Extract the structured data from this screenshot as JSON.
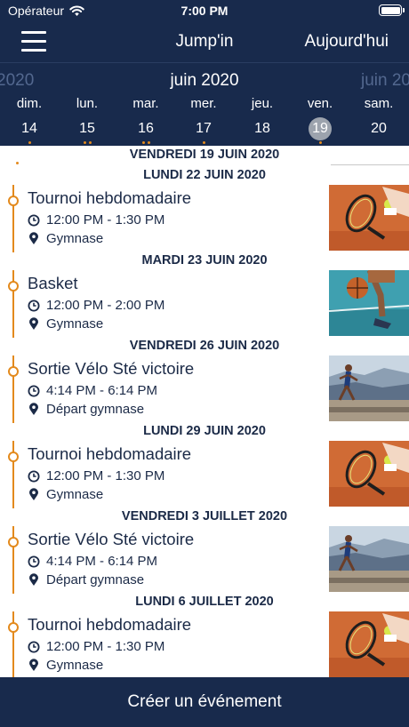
{
  "status": {
    "carrier": "Opérateur",
    "time": "7:00 PM"
  },
  "nav": {
    "title": "Jump'in",
    "today_label": "Aujourd'hui"
  },
  "calendar": {
    "prev_month_fragment": "2020",
    "month": "juin 2020",
    "next_month_fragment": "juin 20",
    "days": [
      {
        "name": "dim.",
        "num": "14",
        "dots": 1,
        "selected": false
      },
      {
        "name": "lun.",
        "num": "15",
        "dots": 2,
        "selected": false
      },
      {
        "name": "mar.",
        "num": "16",
        "dots": 2,
        "selected": false
      },
      {
        "name": "mer.",
        "num": "17",
        "dots": 1,
        "selected": false
      },
      {
        "name": "jeu.",
        "num": "18",
        "dots": 0,
        "selected": false
      },
      {
        "name": "ven.",
        "num": "19",
        "dots": 1,
        "selected": true
      },
      {
        "name": "sam.",
        "num": "20",
        "dots": 0,
        "selected": false
      }
    ]
  },
  "feed": {
    "sticky_header": "VENDREDI 19 JUIN 2020",
    "sections": [
      {
        "date": "LUNDI 22 JUIN 2020",
        "event": {
          "title": "Tournoi hebdomadaire",
          "time": "12:00 PM - 1:30 PM",
          "location": "Gymnase",
          "image": "tennis"
        }
      },
      {
        "date": "MARDI 23 JUIN 2020",
        "event": {
          "title": "Basket",
          "time": "12:00 PM - 2:00 PM",
          "location": "Gymnase",
          "image": "basket"
        }
      },
      {
        "date": "VENDREDI 26 JUIN 2020",
        "event": {
          "title": "Sortie Vélo Sté victoire",
          "time": "4:14 PM - 6:14 PM",
          "location": "Départ gymnase",
          "image": "runner"
        }
      },
      {
        "date": "LUNDI 29 JUIN 2020",
        "event": {
          "title": "Tournoi hebdomadaire",
          "time": "12:00 PM - 1:30 PM",
          "location": "Gymnase",
          "image": "tennis"
        }
      },
      {
        "date": "VENDREDI 3 JUILLET 2020",
        "event": {
          "title": "Sortie Vélo Sté victoire",
          "time": "4:14 PM - 6:14 PM",
          "location": "Départ gymnase",
          "image": "runner"
        }
      },
      {
        "date": "LUNDI 6 JUILLET 2020",
        "event": {
          "title": "Tournoi hebdomadaire",
          "time": "12:00 PM - 1:30 PM",
          "location": "Gymnase",
          "image": "tennis"
        }
      }
    ]
  },
  "footer": {
    "create_label": "Créer un événement"
  },
  "colors": {
    "navy": "#182a4c",
    "accent": "#e38a1d",
    "text": "#1b2a47"
  }
}
